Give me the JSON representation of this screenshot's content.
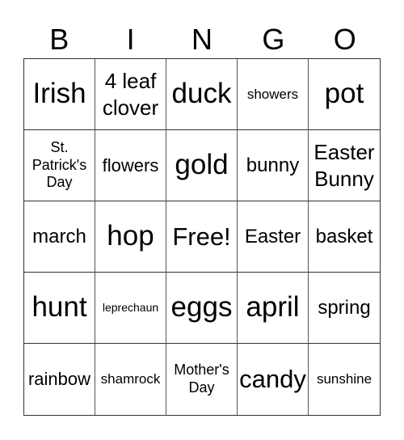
{
  "header": [
    "B",
    "I",
    "N",
    "G",
    "O"
  ],
  "cells": [
    "Irish",
    "4 leaf clover",
    "duck",
    "showers",
    "pot",
    "St. Patrick's Day",
    "flowers",
    "gold",
    "bunny",
    "Easter Bunny",
    "march",
    "hop",
    "Free!",
    "Easter",
    "basket",
    "hunt",
    "leprechaun",
    "eggs",
    "april",
    "spring",
    "rainbow",
    "shamrock",
    "Mother's Day",
    "candy",
    "sunshine"
  ]
}
